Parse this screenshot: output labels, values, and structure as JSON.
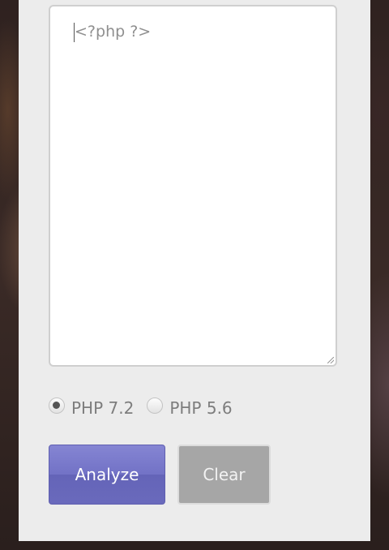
{
  "editor": {
    "placeholder": "<?php ?>"
  },
  "php_versions": {
    "options": [
      {
        "label": "PHP 7.2",
        "checked": true
      },
      {
        "label": "PHP 5.6",
        "checked": false
      }
    ]
  },
  "buttons": {
    "analyze_label": "Analyze",
    "clear_label": "Clear"
  },
  "colors": {
    "analyze_button": "#7272c6",
    "clear_button": "#a6a6a6",
    "panel_background": "#ececec"
  }
}
